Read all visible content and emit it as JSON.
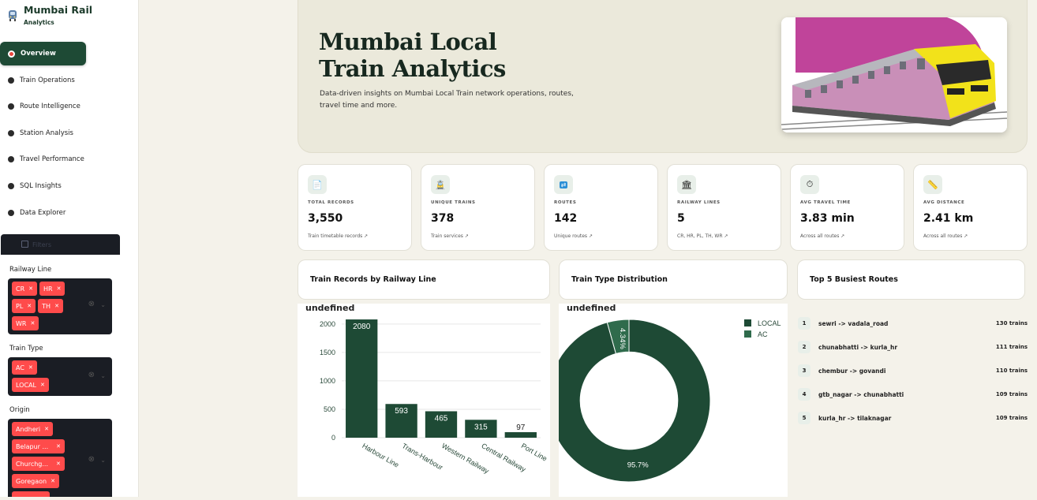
{
  "app": {
    "title": "Mumbai Rail",
    "subtitle": "Analytics"
  },
  "nav": [
    {
      "label": "Overview",
      "active": true
    },
    {
      "label": "Train Operations"
    },
    {
      "label": "Route Intelligence"
    },
    {
      "label": "Station Analysis"
    },
    {
      "label": "Travel Performance"
    },
    {
      "label": "SQL Insights"
    },
    {
      "label": "Data Explorer"
    }
  ],
  "filters": {
    "heading": "Filters",
    "railway_line": {
      "label": "Railway Line",
      "values": [
        "CR",
        "HR",
        "PL",
        "TH",
        "WR"
      ]
    },
    "train_type": {
      "label": "Train Type",
      "values": [
        "AC",
        "LOCAL"
      ]
    },
    "origin": {
      "label": "Origin",
      "values": [
        "Andheri",
        "Belapur ...",
        "Churchg...",
        "Goregaon"
      ]
    }
  },
  "hero": {
    "title_line1": "Mumbai Local",
    "title_line2": "Train Analytics",
    "subtitle": "Data-driven insights on Mumbai Local Train network operations, routes, travel time and more."
  },
  "kpis": [
    {
      "icon": "document-icon",
      "label": "TOTAL RECORDS",
      "value": "3,550",
      "foot": "Train timetable records ↗"
    },
    {
      "icon": "train-icon",
      "label": "UNIQUE TRAINS",
      "value": "378",
      "foot": "Train services ↗"
    },
    {
      "icon": "shuffle-icon",
      "label": "ROUTES",
      "value": "142",
      "foot": "Unique routes ↗"
    },
    {
      "icon": "bank-icon",
      "label": "RAILWAY LINES",
      "value": "5",
      "foot": "CR, HR, PL, TH, WR ↗"
    },
    {
      "icon": "stopwatch-icon",
      "label": "AVG TRAVEL TIME",
      "value": "3.83 min",
      "foot": "Across all routes ↗"
    },
    {
      "icon": "ruler-icon",
      "label": "AVG DISTANCE",
      "value": "2.41 km",
      "foot": "Across all routes ↗"
    }
  ],
  "sections": {
    "records_by_line": "Train Records by Railway Line",
    "type_distribution": "Train Type Distribution",
    "busiest_routes": "Top 5 Busiest Routes"
  },
  "chart_data": [
    {
      "type": "bar",
      "title": "undefined",
      "categories": [
        "Harbour Line",
        "Trans-Harbour",
        "Western Railway",
        "Central Railway",
        "Port Line"
      ],
      "values": [
        2080,
        593,
        465,
        315,
        97
      ],
      "yticks": [
        0,
        500,
        1000,
        1500,
        2000
      ],
      "ylim": [
        0,
        2150
      ],
      "color": "#1e4a35",
      "grid": true
    },
    {
      "type": "pie",
      "title": "undefined",
      "labels": [
        "LOCAL",
        "AC"
      ],
      "values": [
        95.7,
        4.34
      ],
      "display": [
        "95.7%",
        "4.34%"
      ],
      "colors": [
        "#1e4a35",
        "#2f6b4c"
      ],
      "hole": 0.6,
      "legend": "top-right"
    }
  ],
  "top_routes": [
    {
      "rank": "1",
      "route": "sewri -> vadala_road",
      "count": "130 trains"
    },
    {
      "rank": "2",
      "route": "chunabhatti -> kurla_hr",
      "count": "111 trains"
    },
    {
      "rank": "3",
      "route": "chembur -> govandi",
      "count": "110 trains"
    },
    {
      "rank": "4",
      "route": "gtb_nagar -> chunabhatti",
      "count": "109 trains"
    },
    {
      "rank": "5",
      "route": "kurla_hr -> tilaknagar",
      "count": "109 trains"
    }
  ]
}
